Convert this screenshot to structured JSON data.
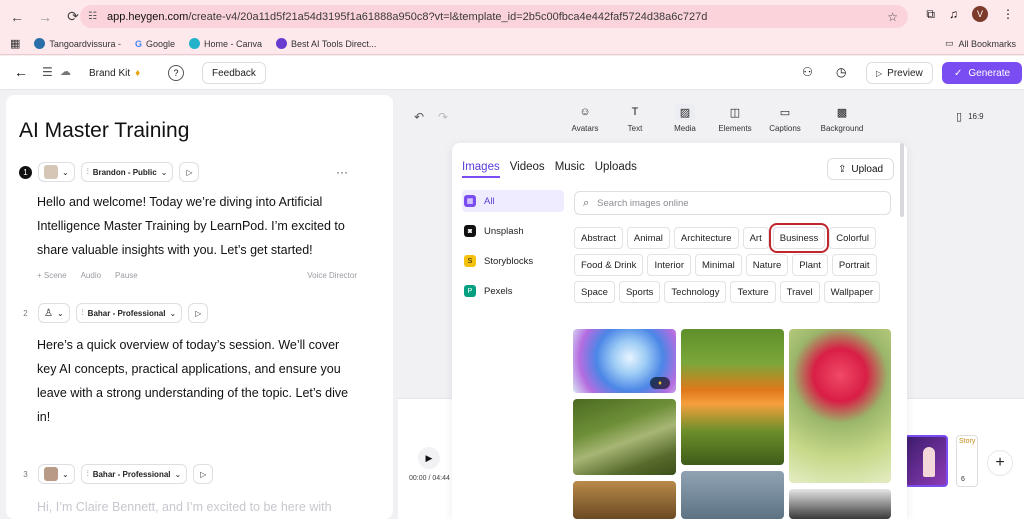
{
  "browser": {
    "url_host": "app.heygen.com",
    "url_path": "/create-v4/20a11d5f21a54d3195f1a61888a950c8?vt=l&template_id=2b5c00fbca4e442faf5724d38a6c727d",
    "profile_initial": "V",
    "bookmarks": [
      "Tangoardvissura -",
      "Google",
      "Home - Canva",
      "Best AI Tools Direct..."
    ],
    "all_bookmarks": "All Bookmarks"
  },
  "header": {
    "brand_kit": "Brand Kit",
    "feedback": "Feedback",
    "preview": "Preview",
    "generate": "Generate"
  },
  "script": {
    "title": "AI Master Training",
    "scenes": [
      {
        "number": "1",
        "voice": "Brandon - Public",
        "text": "Hello and welcome! Today we’re diving into Artificial Intelligence Master Training by LearnPod. I’m excited to share valuable insights with you. Let’s get started!",
        "meta": [
          "+ Scene",
          "Audio",
          "Pause",
          "Voice Director"
        ]
      },
      {
        "number": "2",
        "voice": "Bahar - Professional",
        "text": "Here’s a quick overview of today’s session. We’ll cover key AI concepts, practical applications, and ensure you leave with a strong understanding of the topic. Let’s dive in!"
      },
      {
        "number": "3",
        "voice": "Bahar - Professional",
        "text": "Hi, I’m Claire Bennett, and I’m excited to be here with"
      }
    ]
  },
  "toolbar": {
    "items": [
      {
        "label": "Avatars",
        "icon": "avatar-icon"
      },
      {
        "label": "Text",
        "icon": "text-icon"
      },
      {
        "label": "Media",
        "icon": "image-icon"
      },
      {
        "label": "Elements",
        "icon": "shapes-icon"
      },
      {
        "label": "Captions",
        "icon": "captions-icon"
      },
      {
        "label": "Background",
        "icon": "background-icon"
      }
    ],
    "ratio": "16:9"
  },
  "media": {
    "tabs": [
      "Images",
      "Videos",
      "Music",
      "Uploads"
    ],
    "upload": "Upload",
    "sources": [
      {
        "label": "All",
        "color": "#7a4df2"
      },
      {
        "label": "Unsplash",
        "color": "#111111"
      },
      {
        "label": "Storyblocks",
        "color": "#f4c20d"
      },
      {
        "label": "Pexels",
        "color": "#05a081"
      }
    ],
    "search_placeholder": "Search images online",
    "categories": [
      [
        "Abstract",
        "Animal",
        "Architecture",
        "Art",
        "Business",
        "Colorful"
      ],
      [
        "Food & Drink",
        "Interior",
        "Minimal",
        "Nature",
        "Plant",
        "Portrait"
      ],
      [
        "Space",
        "Sports",
        "Technology",
        "Texture",
        "Travel",
        "Wallpaper"
      ]
    ]
  },
  "timeline": {
    "time": "00:00 / 04:44",
    "story_label": "Story",
    "scene_count": "6"
  }
}
